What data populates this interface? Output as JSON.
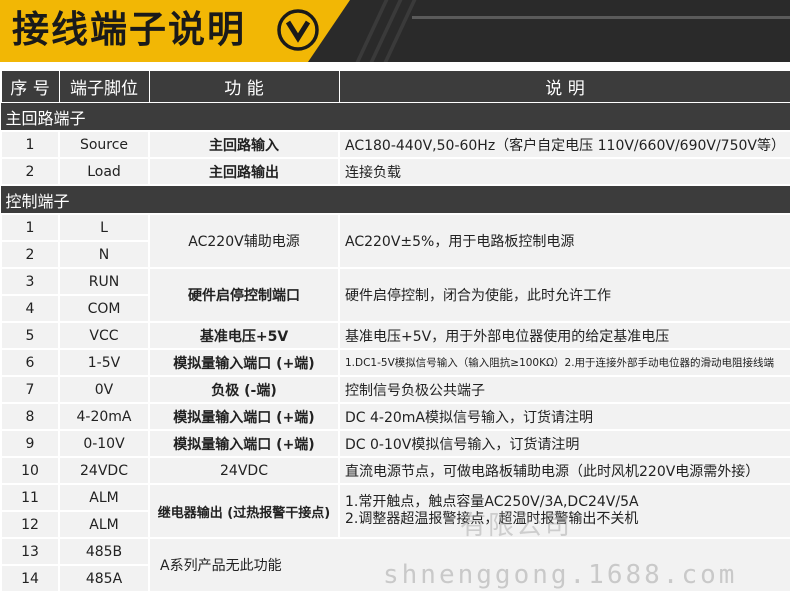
{
  "banner": {
    "title": "接线端子说明",
    "icon": "chevron-down-circle-icon",
    "accent": "#f2b705",
    "dark": "#2a2a2a"
  },
  "headers": [
    "序  号",
    "端子脚位",
    "功    能",
    "说    明"
  ],
  "sections": [
    {
      "title": "主回路端子"
    },
    {
      "title": "控制端子"
    }
  ],
  "main_rows": [
    {
      "no": "1",
      "pin": "Source",
      "func": "主回路输入",
      "desc": "AC180-440V,50-60Hz（客户自定电压 110V/660V/690V/750V等）"
    },
    {
      "no": "2",
      "pin": "Load",
      "func": "主回路输出",
      "desc": "连接负载"
    }
  ],
  "control_rows": [
    {
      "no": "1",
      "pin": "L",
      "func": "AC220V辅助电源",
      "desc": "AC220V±5%，用于电路板控制电源"
    },
    {
      "no": "2",
      "pin": "N"
    },
    {
      "no": "3",
      "pin": "RUN",
      "func": "硬件启停控制端口",
      "desc": "硬件启停控制，闭合为使能，此时允许工作"
    },
    {
      "no": "4",
      "pin": "COM"
    },
    {
      "no": "5",
      "pin": "VCC",
      "func": "基准电压+5V",
      "desc": "基准电压+5V，用于外部电位器使用的给定基准电压"
    },
    {
      "no": "6",
      "pin": "1-5V",
      "func": "模拟量输入端口 (+端)",
      "desc": "1.DC1-5V模拟信号输入（输入阻抗≥100KΩ）2.用于连接外部手动电位器的滑动电阻接线端"
    },
    {
      "no": "7",
      "pin": "0V",
      "func": "负极 (-端)",
      "desc": "控制信号负极公共端子"
    },
    {
      "no": "8",
      "pin": "4-20mA",
      "func": "模拟量输入端口 (+端)",
      "desc": "DC 4-20mA模拟信号输入，订货请注明"
    },
    {
      "no": "9",
      "pin": "0-10V",
      "func": "模拟量输入端口 (+端)",
      "desc": "DC 0-10V模拟信号输入，订货请注明"
    },
    {
      "no": "10",
      "pin": "24VDC",
      "func": "24VDC",
      "desc": "直流电源节点，可做电路板辅助电源（此时风机220V电源需外接）"
    },
    {
      "no": "11",
      "pin": "ALM",
      "func": "继电器输出 (过热报警干接点)",
      "desc": "1.常开触点，触点容量AC250V/3A,DC24V/5A",
      "desc2": "2.调整器超温报警接点，超温时报警输出不关机"
    },
    {
      "no": "12",
      "pin": "ALM"
    },
    {
      "no": "13",
      "pin": "485B",
      "desc": "A系列产品无此功能"
    },
    {
      "no": "14",
      "pin": "485A"
    }
  ],
  "watermark": {
    "company": "有限公司",
    "site": "shnenggong.1688.com"
  }
}
